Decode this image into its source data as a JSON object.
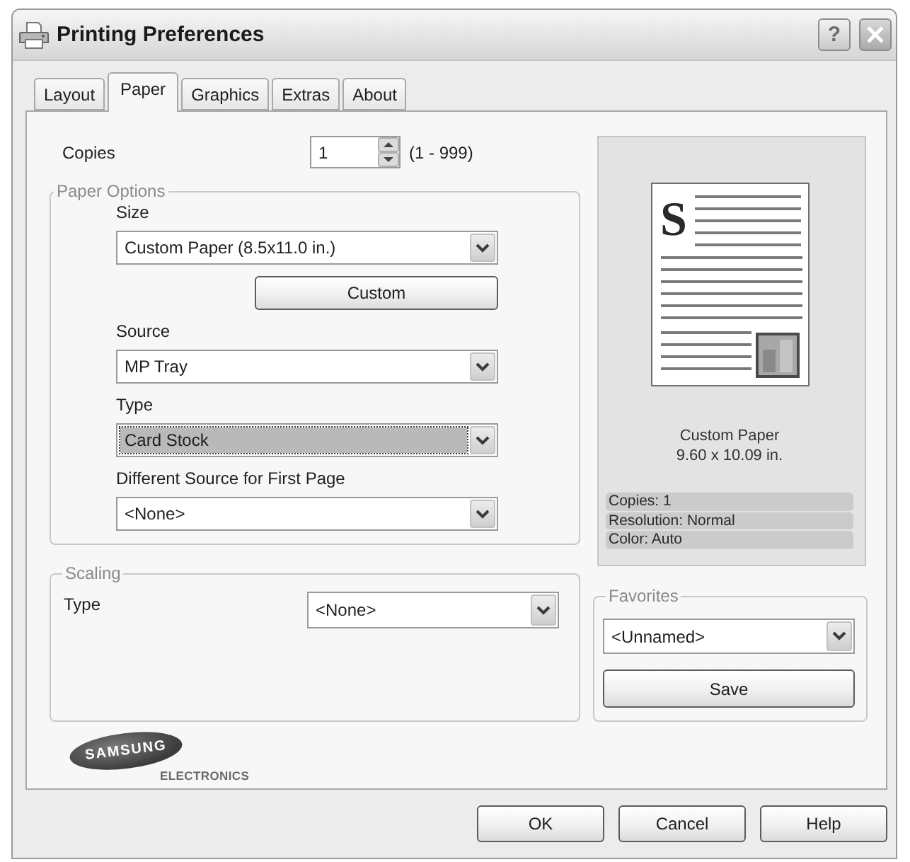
{
  "window": {
    "title": "Printing Preferences",
    "controls": [
      {
        "kind": "help",
        "label": "?"
      },
      {
        "kind": "close"
      }
    ]
  },
  "tabs": [
    {
      "label": "Layout",
      "selected": false
    },
    {
      "label": "Paper",
      "selected": true
    },
    {
      "label": "Graphics",
      "selected": false
    },
    {
      "label": "Extras",
      "selected": false
    },
    {
      "label": "About",
      "selected": false
    }
  ],
  "copies": {
    "label": "Copies",
    "value": "1",
    "range": "(1 - 999)"
  },
  "paper_options": {
    "title": "Paper Options",
    "items": [
      {
        "kind": "select",
        "label": "Size",
        "value": "Custom Paper (8.5x11.0 in.)",
        "focused": false
      },
      {
        "kind": "button",
        "label": "Custom"
      },
      {
        "kind": "select",
        "label": "Source",
        "value": "MP Tray",
        "focused": false
      },
      {
        "kind": "select",
        "label": "Type",
        "value": "Card Stock",
        "focused": true
      },
      {
        "kind": "select",
        "label": "Different Source for First Page",
        "value": "<None>",
        "focused": false
      }
    ]
  },
  "preview": {
    "page_letter": "S",
    "paper_name": "Custom Paper",
    "dimensions": "9.60 x 10.09 in.",
    "summary": [
      "Copies: 1",
      "Resolution: Normal",
      "Color: Auto"
    ]
  },
  "scaling": {
    "title": "Scaling",
    "label": "Type",
    "value": "<None>"
  },
  "favorites": {
    "title": "Favorites",
    "value": "<Unnamed>",
    "button": "Save"
  },
  "logo": {
    "brand": "SAMSUNG",
    "subtitle": "ELECTRONICS"
  },
  "buttons": [
    "OK",
    "Cancel",
    "Help"
  ]
}
